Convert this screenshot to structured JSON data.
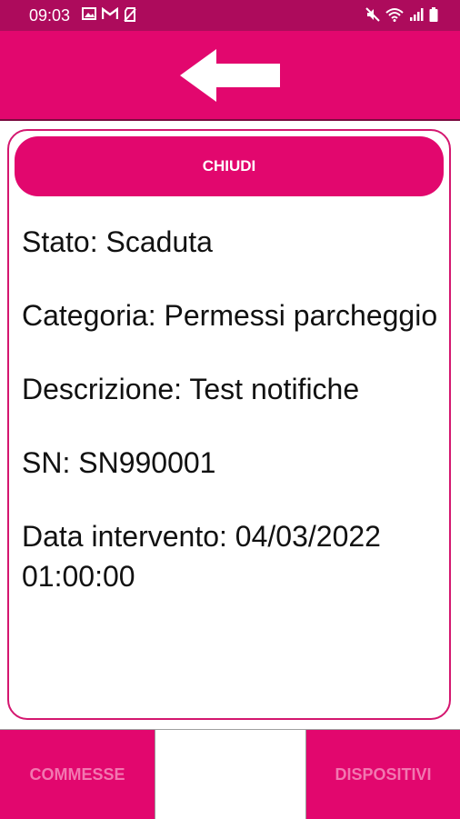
{
  "status_bar": {
    "time": "09:03",
    "left_icons": [
      "image-icon",
      "gmail-icon",
      "no-sim-icon"
    ],
    "right_icons": [
      "mute-icon",
      "wifi-icon",
      "signal-icon",
      "battery-icon"
    ]
  },
  "colors": {
    "primary": "#e2076e",
    "status_bar": "#ad0b5c",
    "nav_text": "#f277b0"
  },
  "header": {
    "back_icon": "arrow-left-icon"
  },
  "card": {
    "close_label": "CHIUDI",
    "fields": [
      "Stato: Scaduta",
      "Categoria: Permessi parcheggio",
      "Descrizione: Test notifiche",
      "SN: SN990001",
      "Data intervento: 04/03/2022 01:00:00"
    ]
  },
  "bottom_nav": {
    "left_label": "COMMESSE",
    "right_label": "DISPOSITIVI"
  }
}
